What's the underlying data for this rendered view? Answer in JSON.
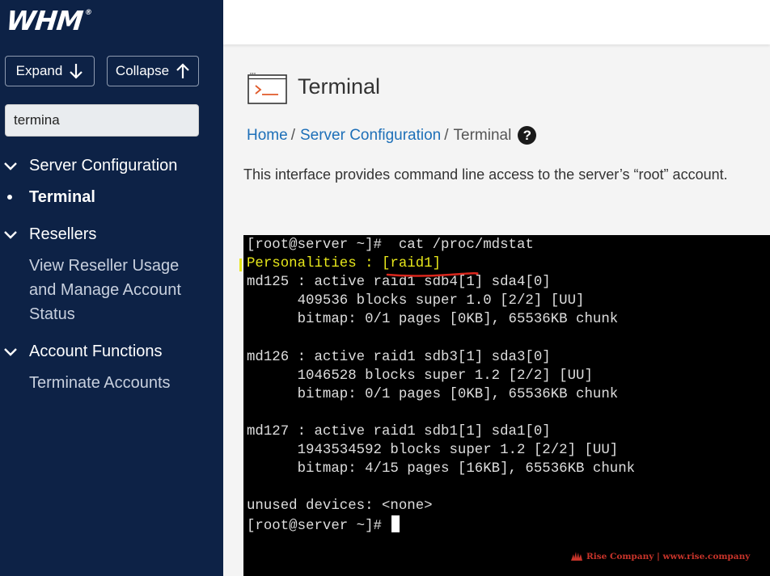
{
  "sidebar": {
    "logo": "WHM",
    "expand_label": "Expand",
    "collapse_label": "Collapse",
    "search_value": "termina",
    "sections": [
      {
        "label": "Server Configuration",
        "items": [
          "Terminal"
        ]
      },
      {
        "label": "Resellers",
        "items": [
          "View Reseller Usage",
          "and Manage Account",
          "Status"
        ]
      },
      {
        "label": "Account Functions",
        "items": [
          "Terminate Accounts"
        ]
      }
    ]
  },
  "page": {
    "title": "Terminal",
    "breadcrumb": [
      "Home",
      "Server Configuration",
      "Terminal"
    ],
    "help_glyph": "?",
    "description": "This interface provides command line access to the server’s “root” account."
  },
  "terminal": {
    "lines": [
      "[root@server ~]#  cat /proc/mdstat",
      "Personalities : [raid1]",
      "md125 : active raid1 sdb4[1] sda4[0]",
      "      409536 blocks super 1.0 [2/2] [UU]",
      "      bitmap: 0/1 pages [0KB], 65536KB chunk",
      "",
      "md126 : active raid1 sdb3[1] sda3[0]",
      "      1046528 blocks super 1.2 [2/2] [UU]",
      "      bitmap: 0/1 pages [0KB], 65536KB chunk",
      "",
      "md127 : active raid1 sdb1[1] sda1[0]",
      "      1943534592 blocks super 1.2 [2/2] [UU]",
      "      bitmap: 4/15 pages [16KB], 65536KB chunk",
      "",
      "unused devices: <none>"
    ],
    "prompt": "[root@server ~]# "
  },
  "watermark": "Rise Company | www.rise.company",
  "colors": {
    "sidebar_bg": "#0d2246",
    "link": "#1d6fb8",
    "terminal_bg": "#000000",
    "terminal_text": "#dedede",
    "highlight_yellow": "#e7e71a",
    "annotation_red": "#d9261c"
  }
}
